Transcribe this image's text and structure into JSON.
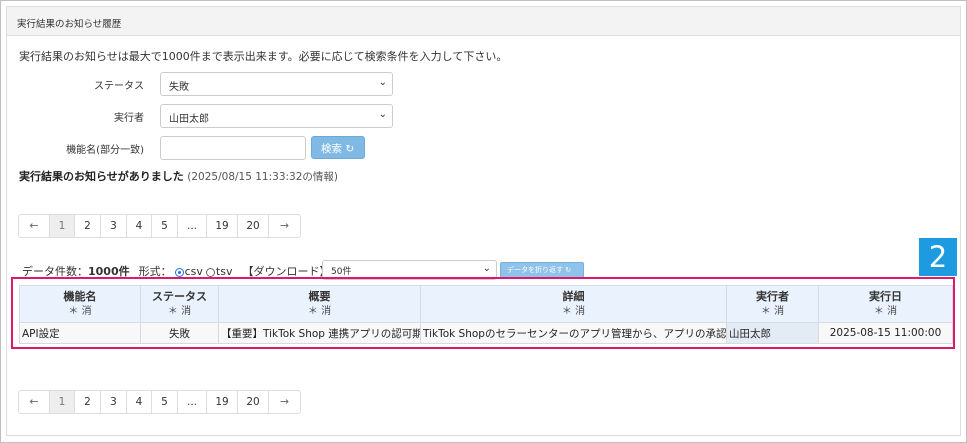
{
  "panel": {
    "title": "実行結果のお知らせ履歴"
  },
  "intro_text": "実行結果のお知らせは最大で1000件まで表示出来ます。必要に応じて検索条件を入力して下さい。",
  "filters": {
    "status_label": "ステータス",
    "status_value": "失敗",
    "executor_label": "実行者",
    "executor_value": "山田太郎",
    "function_label": "機能名(部分一致)",
    "function_value": "",
    "search_button": "検索",
    "search_icon": "refresh-icon"
  },
  "notice": {
    "message": "実行結果のお知らせがありました",
    "timestamp": "(2025/08/15 11:33:32の情報)"
  },
  "pagination": {
    "prev": "←",
    "pages": [
      "1",
      "2",
      "3",
      "4",
      "5",
      "...",
      "19",
      "20"
    ],
    "next": "→",
    "active_page": "1"
  },
  "result_info": {
    "count_label": "データ件数：",
    "count_value": "1000件",
    "format_label": "形式：",
    "format_csv": "csv",
    "format_tsv": "tsv",
    "format_selected": "csv",
    "download_link": "【ダウンロード】",
    "page_size_value": "50件",
    "wrap_button": "データを折り返す"
  },
  "badge": {
    "number": "2"
  },
  "table": {
    "columns": [
      {
        "label": "機能名",
        "sub": "＊ 消"
      },
      {
        "label": "ステータス",
        "sub": "＊ 消"
      },
      {
        "label": "概要",
        "sub": "＊ 消"
      },
      {
        "label": "詳細",
        "sub": "＊ 消"
      },
      {
        "label": "実行者",
        "sub": "＊ 消"
      },
      {
        "label": "実行日",
        "sub": "＊ 消"
      }
    ],
    "rows": [
      {
        "function": "API設定",
        "status": "失敗",
        "summary": "【重要】TikTok Shop 連携アプリの認可期限",
        "detail": "TikTok Shopのセラーセンターのアプリ管理から、アプリの承認",
        "executor": "山田太郎",
        "date": "2025-08-15 11:00:00"
      }
    ]
  },
  "colors": {
    "accent_blue": "#1e9be0",
    "highlight_border": "#e0186b",
    "header_bg": "#eaf3fd",
    "button_blue": "#7fb9e4"
  }
}
